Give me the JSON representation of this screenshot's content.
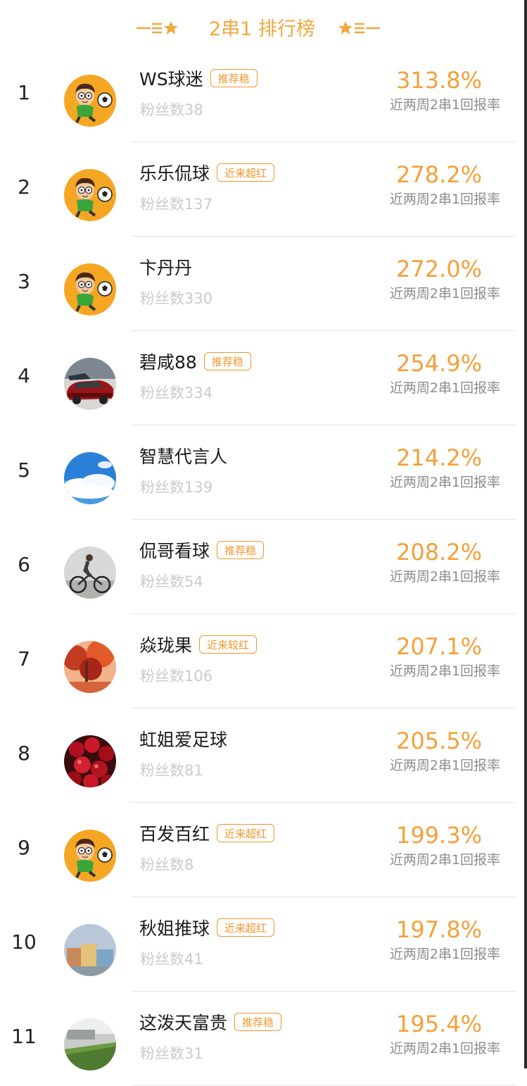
{
  "header": {
    "title": "2串1 排行榜"
  },
  "colors": {
    "accent": "#f5a03a",
    "tag_border": "#f0962c",
    "muted": "#cbcbcb"
  },
  "rate_label": "近两周2串1回报率",
  "rows": [
    {
      "rank": "1",
      "name": "WS球迷",
      "tag": "推荐稳",
      "fans": "粉丝数38",
      "rate": "313.8%",
      "avatar": "cartoon-soccer-avatar"
    },
    {
      "rank": "2",
      "name": "乐乐侃球",
      "tag": "近来超红",
      "fans": "粉丝数137",
      "rate": "278.2%",
      "avatar": "cartoon-soccer-avatar"
    },
    {
      "rank": "3",
      "name": "卞丹丹",
      "tag": "",
      "fans": "粉丝数330",
      "rate": "272.0%",
      "avatar": "cartoon-soccer-avatar"
    },
    {
      "rank": "4",
      "name": "碧咸88",
      "tag": "推荐稳",
      "fans": "粉丝数334",
      "rate": "254.9%",
      "avatar": "red-car-avatar"
    },
    {
      "rank": "5",
      "name": "智慧代言人",
      "tag": "",
      "fans": "粉丝数139",
      "rate": "214.2%",
      "avatar": "sky-clouds-avatar"
    },
    {
      "rank": "6",
      "name": "侃哥看球",
      "tag": "推荐稳",
      "fans": "粉丝数54",
      "rate": "208.2%",
      "avatar": "cyclist-avatar"
    },
    {
      "rank": "7",
      "name": "焱珑果",
      "tag": "近来较红",
      "fans": "粉丝数106",
      "rate": "207.1%",
      "avatar": "autumn-trees-avatar"
    },
    {
      "rank": "8",
      "name": "虹姐爱足球",
      "tag": "",
      "fans": "粉丝数81",
      "rate": "205.5%",
      "avatar": "cherries-avatar"
    },
    {
      "rank": "9",
      "name": "百发百红",
      "tag": "近来超红",
      "fans": "粉丝数8",
      "rate": "199.3%",
      "avatar": "cartoon-soccer-avatar"
    },
    {
      "rank": "10",
      "name": "秋姐推球",
      "tag": "近来超红",
      "fans": "粉丝数41",
      "rate": "197.8%",
      "avatar": "buildings-avatar"
    },
    {
      "rank": "11",
      "name": "这泼天富贵",
      "tag": "推荐稳",
      "fans": "粉丝数31",
      "rate": "195.4%",
      "avatar": "grass-street-avatar"
    }
  ]
}
